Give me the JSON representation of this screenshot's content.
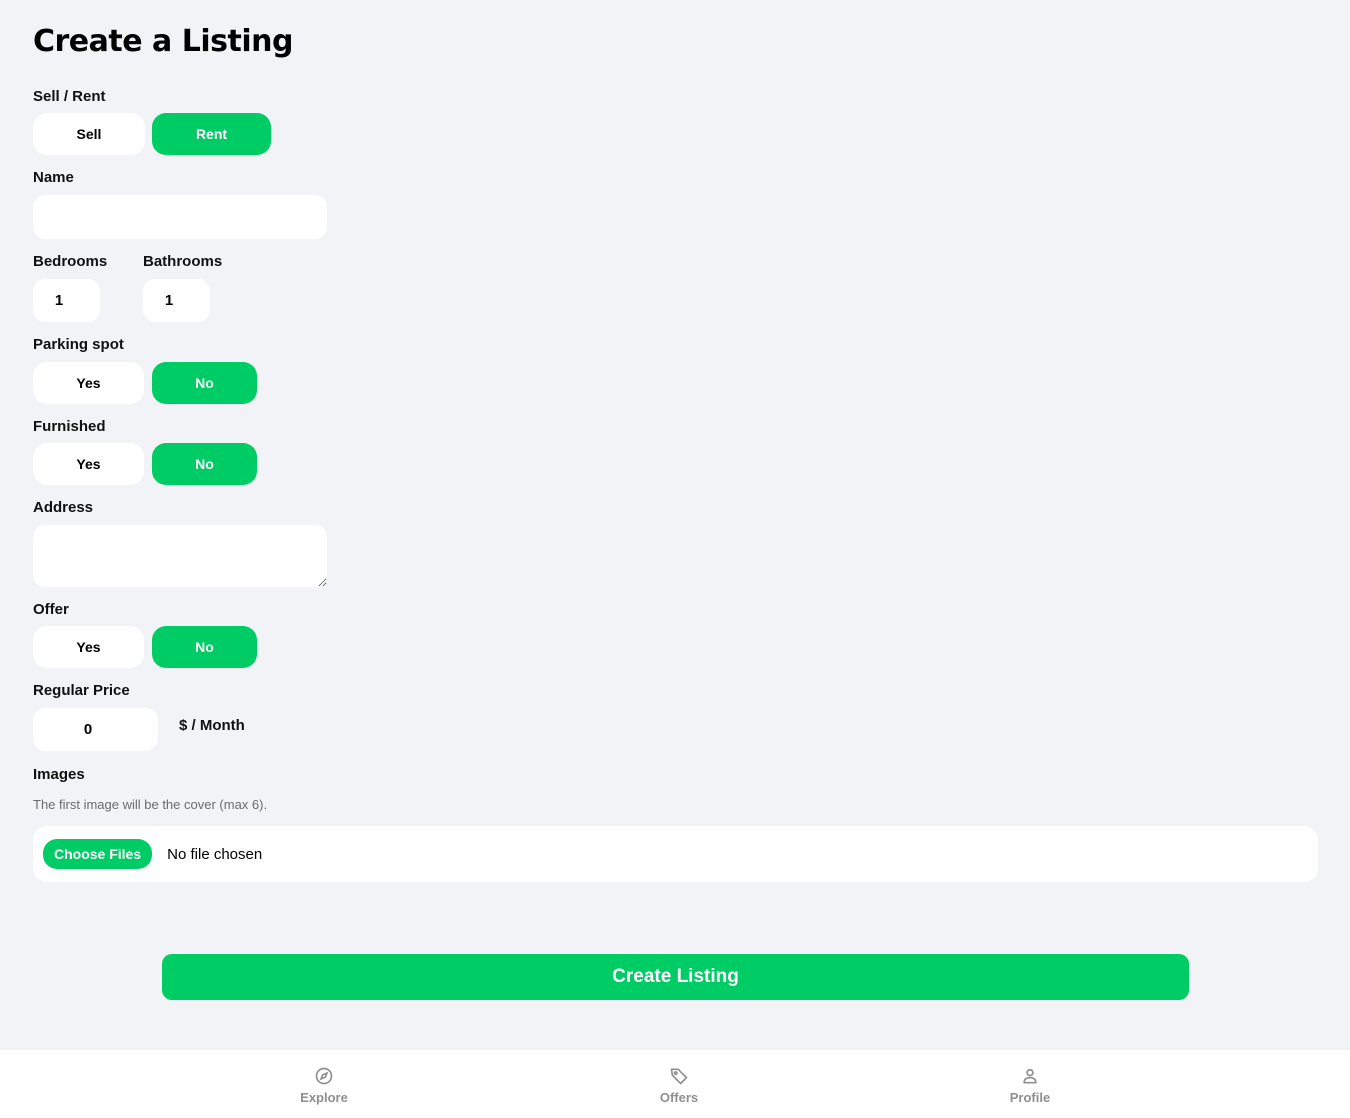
{
  "title": "Create a Listing",
  "type_field": {
    "label": "Sell / Rent",
    "options": [
      "Sell",
      "Rent"
    ],
    "selected": "Rent"
  },
  "name_field": {
    "label": "Name",
    "value": ""
  },
  "bedrooms": {
    "label": "Bedrooms",
    "value": "1"
  },
  "bathrooms": {
    "label": "Bathrooms",
    "value": "1"
  },
  "parking": {
    "label": "Parking spot",
    "yes": "Yes",
    "no": "No",
    "selected": "No"
  },
  "furnished": {
    "label": "Furnished",
    "yes": "Yes",
    "no": "No",
    "selected": "No"
  },
  "address": {
    "label": "Address",
    "value": ""
  },
  "offer": {
    "label": "Offer",
    "yes": "Yes",
    "no": "No",
    "selected": "No"
  },
  "regular_price": {
    "label": "Regular Price",
    "value": "0",
    "unit": "$ / Month"
  },
  "images": {
    "label": "Images",
    "hint": "The first image will be the cover (max 6).",
    "choose_label": "Choose Files",
    "status": "No file chosen"
  },
  "submit_label": "Create Listing",
  "nav": {
    "explore": "Explore",
    "offers": "Offers",
    "profile": "Profile"
  },
  "colors": {
    "accent": "#00cc66",
    "background": "#f2f3f7",
    "nav_inactive": "#8f8f8f"
  }
}
